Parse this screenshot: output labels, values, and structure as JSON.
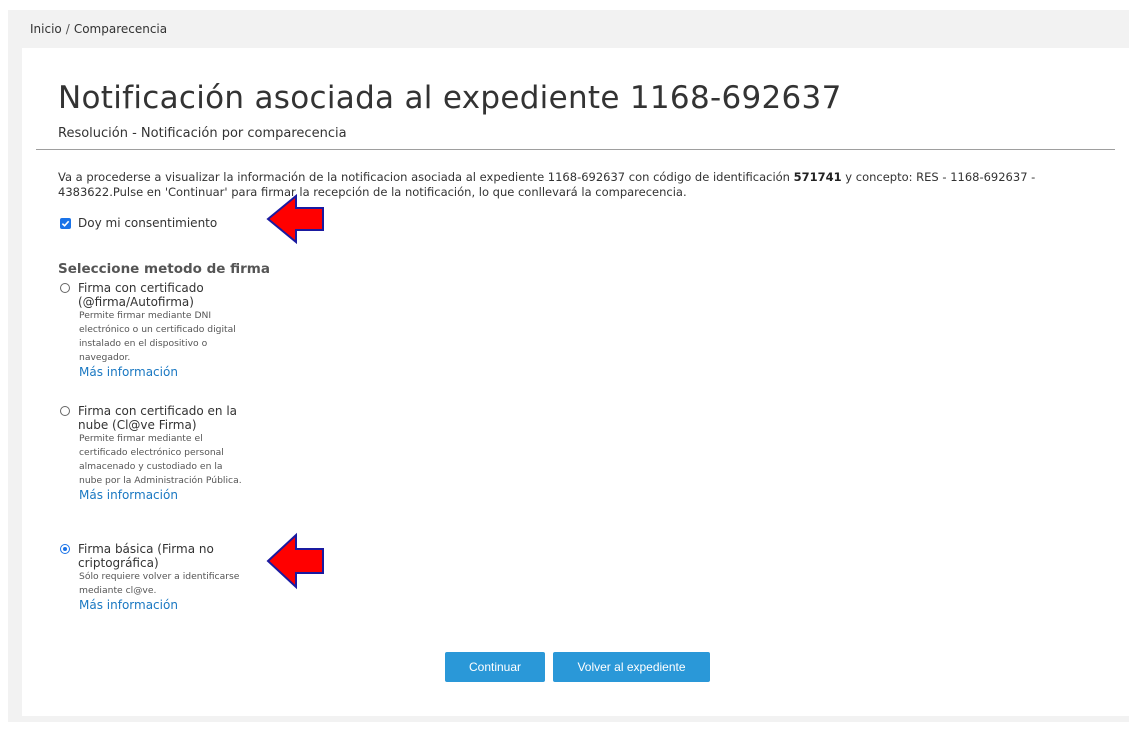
{
  "breadcrumb": {
    "home": "Inicio",
    "separator": "/",
    "current": "Comparecencia"
  },
  "header": {
    "title": "Notificación asociada al expediente 1168-692637",
    "subtitle": "Resolución - Notificación por comparecencia"
  },
  "intro": {
    "text_before": "Va a procederse a visualizar la información de la notificacion asociada al expediente 1168-692637 con código de identificación ",
    "code": "571741",
    "text_after": " y concepto: RES - 1168-692637 - 4383622.Pulse en 'Continuar' para firmar la recepción de la notificación, lo que conllevará la comparecencia."
  },
  "consent": {
    "label": "Doy mi consentimiento",
    "checked": true
  },
  "sign_method": {
    "title": "Seleccione metodo de firma",
    "options": [
      {
        "label": "Firma con certificado (@firma/Autofirma)",
        "description": "Permite firmar mediante DNI electrónico o un certificado digital instalado en el dispositivo o navegador.",
        "more": "Más información",
        "selected": false
      },
      {
        "label": "Firma con certificado en la nube (Cl@ve Firma)",
        "description": "Permite firmar mediante el certificado electrónico personal almacenado y custodiado en la nube por la Administración Pública.",
        "more": "Más información",
        "selected": false
      },
      {
        "label": "Firma básica (Firma no criptográfica)",
        "description": "Sólo requiere volver a identificarse mediante cl@ve.",
        "more": "Más información",
        "selected": true
      }
    ]
  },
  "buttons": {
    "continue": "Continuar",
    "back": "Volver al expediente"
  },
  "colors": {
    "accent": "#2a98d8",
    "link": "#1a78c2",
    "annotation_arrow": "#ff0000"
  },
  "icons": {
    "annotation": "red-arrow-icon",
    "checkbox": "checkbox-checked-icon"
  }
}
